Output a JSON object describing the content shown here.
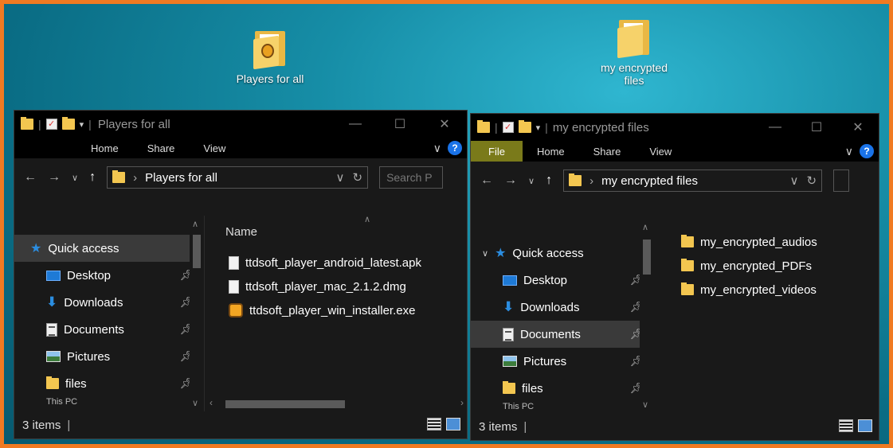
{
  "desktop": {
    "icons": [
      {
        "label": "Players for all",
        "icon": "folder-with-logo-icon"
      },
      {
        "label": "my encrypted files",
        "icon": "folder-icon"
      }
    ]
  },
  "left_window": {
    "title": "Players for all",
    "ribbon": {
      "home": "Home",
      "share": "Share",
      "view": "View"
    },
    "address": "Players for all",
    "search_placeholder": "Search P",
    "sidebar": {
      "quick_access": "Quick access",
      "items": [
        "Desktop",
        "Downloads",
        "Documents",
        "Pictures",
        "files"
      ],
      "partial": "This PC"
    },
    "column_header": "Name",
    "files": [
      {
        "name": "ttdsoft_player_android_latest.apk",
        "icon": "file-icon"
      },
      {
        "name": "ttdsoft_player_mac_2.1.2.dmg",
        "icon": "file-icon"
      },
      {
        "name": "ttdsoft_player_win_installer.exe",
        "icon": "installer-icon"
      }
    ],
    "status": "3 items"
  },
  "right_window": {
    "title": "my encrypted files",
    "ribbon": {
      "file": "File",
      "home": "Home",
      "share": "Share",
      "view": "View"
    },
    "address": "my encrypted files",
    "sidebar": {
      "quick_access": "Quick access",
      "items": [
        "Desktop",
        "Downloads",
        "Documents",
        "Pictures",
        "files"
      ],
      "selected": "Documents",
      "partial": "This PC"
    },
    "files": [
      {
        "name": "my_encrypted_audios",
        "icon": "folder-icon"
      },
      {
        "name": "my_encrypted_PDFs",
        "icon": "folder-icon"
      },
      {
        "name": "my_encrypted_videos",
        "icon": "folder-icon"
      }
    ],
    "status": "3 items"
  },
  "colors": {
    "accent": "#f07a22",
    "explorer_bg": "#191919",
    "file_tab": "#7a7a1a",
    "help": "#1a73e8"
  }
}
